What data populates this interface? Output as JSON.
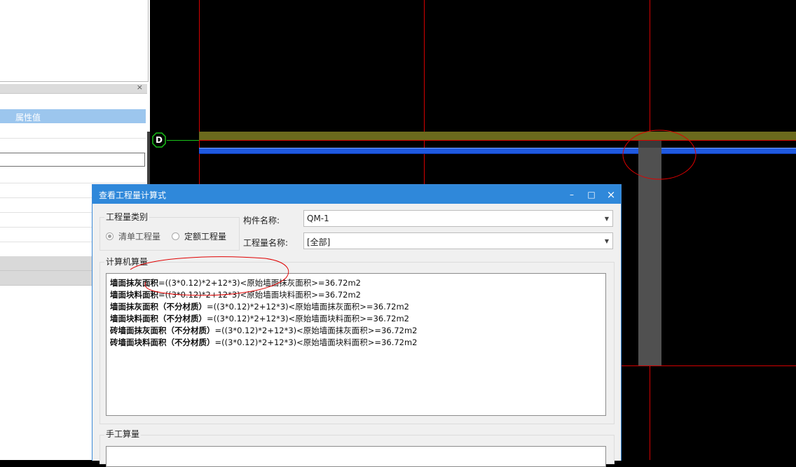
{
  "left_panel": {
    "close_glyph": "×",
    "property_value_header": "属性值"
  },
  "cad": {
    "axis_label": "D",
    "colors": {
      "grid": "#d40000",
      "axis_line": "#19c219",
      "wall_top": "#6b6a1d",
      "wall_face": "#1f5ae0",
      "column": "#505050"
    }
  },
  "dialog": {
    "title": "查看工程量计算式",
    "buttons": {
      "minimize": "–",
      "maximize": "□",
      "close": "×"
    },
    "quantity_type": {
      "title": "工程量类别",
      "options": [
        {
          "label": "清单工程量",
          "checked": true
        },
        {
          "label": "定额工程量",
          "checked": false
        }
      ]
    },
    "component_name": {
      "label": "构件名称:",
      "value": "QM-1"
    },
    "quantity_name": {
      "label": "工程量名称:",
      "value": "[全部]"
    },
    "computer_calc": {
      "title": "计算机算量",
      "lines": [
        {
          "name": "墙面抹灰面积",
          "formula": "=((3*0.12)*2+12*3)<原始墙面抹灰面积>=36.72m2"
        },
        {
          "name": "墙面块料面积",
          "formula": "=((3*0.12)*2+12*3)<原始墙面块料面积>=36.72m2"
        },
        {
          "name": "墙面抹灰面积（不分材质）",
          "formula": "=((3*0.12)*2+12*3)<原始墙面抹灰面积>=36.72m2"
        },
        {
          "name": "墙面块料面积（不分材质）",
          "formula": "=((3*0.12)*2+12*3)<原始墙面块料面积>=36.72m2"
        },
        {
          "name": "砖墙面抹灰面积（不分材质）",
          "formula": "=((3*0.12)*2+12*3)<原始墙面抹灰面积>=36.72m2"
        },
        {
          "name": "砖墙面块料面积（不分材质）",
          "formula": "=((3*0.12)*2+12*3)<原始墙面块料面积>=36.72m2"
        }
      ]
    },
    "manual_calc": {
      "title": "手工算量"
    },
    "accent_color": "#2f88da"
  }
}
